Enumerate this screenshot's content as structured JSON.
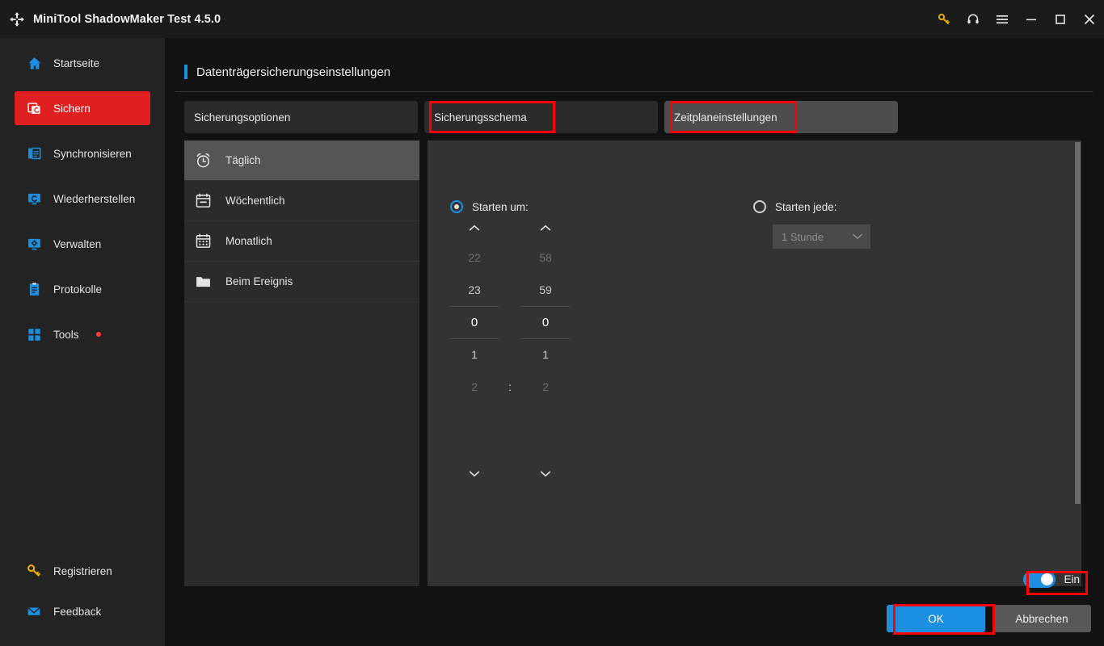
{
  "window": {
    "title": "MiniTool ShadowMaker Test 4.5.0",
    "logo_icon": "shadowmaker-logo-icon",
    "controls": [
      {
        "name": "key-icon",
        "label": "Registrieren"
      },
      {
        "name": "headset-icon",
        "label": "Support"
      },
      {
        "name": "hamburger-menu-icon",
        "label": "Menü"
      },
      {
        "name": "minimize-icon",
        "label": "Minimieren"
      },
      {
        "name": "maximize-icon",
        "label": "Maximieren"
      },
      {
        "name": "close-icon",
        "label": "Schließen"
      }
    ]
  },
  "sidebar": {
    "items": [
      {
        "label": "Startseite",
        "icon": "home-icon",
        "active": false
      },
      {
        "label": "Sichern",
        "icon": "backup-icon",
        "active": true
      },
      {
        "label": "Synchronisieren",
        "icon": "sync-icon",
        "active": false
      },
      {
        "label": "Wiederherstellen",
        "icon": "restore-icon",
        "active": false
      },
      {
        "label": "Verwalten",
        "icon": "manage-icon",
        "active": false
      },
      {
        "label": "Protokolle",
        "icon": "logs-icon",
        "active": false
      },
      {
        "label": "Tools",
        "icon": "tools-icon",
        "active": false,
        "badge": true
      }
    ],
    "bottom_items": [
      {
        "label": "Registrieren",
        "icon": "key-icon"
      },
      {
        "label": "Feedback",
        "icon": "mail-icon"
      }
    ]
  },
  "page": {
    "title": "Datenträgersicherungseinstellungen",
    "accent_color": "#1d8fe1"
  },
  "tabs": [
    {
      "label": "Sicherungsoptionen",
      "active": false,
      "highlighted": false
    },
    {
      "label": "Sicherungsschema",
      "active": false,
      "highlighted": true
    },
    {
      "label": "Zeitplaneinstellungen",
      "active": true,
      "highlighted": true
    }
  ],
  "schedule_list": [
    {
      "label": "Täglich",
      "icon": "alarm-clock-icon",
      "active": true
    },
    {
      "label": "Wöchentlich",
      "icon": "calendar-week-icon",
      "active": false
    },
    {
      "label": "Monatlich",
      "icon": "calendar-month-icon",
      "active": false
    },
    {
      "label": "Beim Ereignis",
      "icon": "folder-icon",
      "active": false
    }
  ],
  "detail": {
    "start_at": {
      "label": "Starten um:",
      "selected": true
    },
    "start_every": {
      "label": "Starten jede:",
      "selected": false
    },
    "interval_select": {
      "value": "1 Stunde",
      "disabled": true,
      "chevron_icon": "chevron-down-icon"
    },
    "time_picker": {
      "up_icon": "chevron-up-icon",
      "down_icon": "chevron-down-icon",
      "separator": ":",
      "hours": [
        "22",
        "23",
        "0",
        "1",
        "2"
      ],
      "minutes": [
        "58",
        "59",
        "0",
        "1",
        "2"
      ],
      "selected_hour": "0",
      "selected_minute": "0"
    }
  },
  "footer": {
    "toggle": {
      "label": "Ein",
      "on": true,
      "highlighted": true
    },
    "ok_label": "OK",
    "cancel_label": "Abbrechen"
  }
}
